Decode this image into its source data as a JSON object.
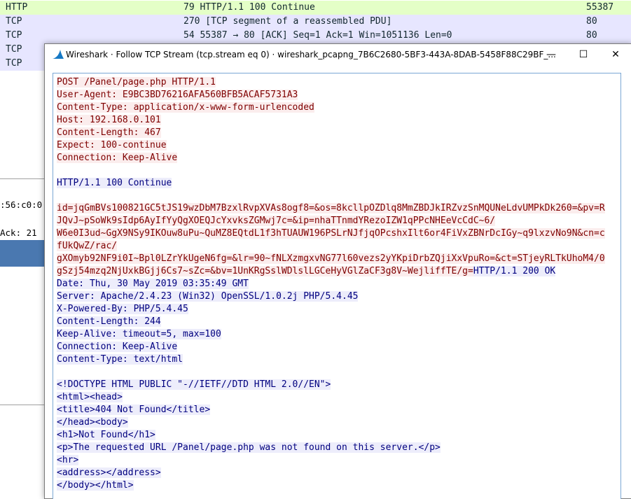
{
  "packet_list": [
    {
      "proto": "HTTP",
      "info": "79 HTTP/1.1 100 Continue",
      "port": "55387",
      "bg": "#e4ffc7"
    },
    {
      "proto": "TCP",
      "info": "270 [TCP segment of a reassembled PDU]",
      "port": "80",
      "bg": "#e7e6ff"
    },
    {
      "proto": "TCP",
      "info": "54 55387 → 80 [ACK] Seq=1 Ack=1 Win=1051136 Len=0",
      "port": "80",
      "bg": "#e7e6ff"
    },
    {
      "proto": "TCP",
      "info": "",
      "port": "",
      "bg": "#e7e6ff"
    },
    {
      "proto": "TCP",
      "info": "",
      "port": "",
      "bg": "#e7e6ff"
    }
  ],
  "background_details": {
    "mac_fragment": ":56:c0:0",
    "ack_fragment": "Ack: 21"
  },
  "dialog": {
    "title": "Wireshark · Follow TCP Stream (tcp.stream eq 0) · wireshark_pcapng_7B6C2680-5BF3-443A-8DAB-5458F88C29BF_...",
    "minimize": "—",
    "maximize": "☐",
    "close": "✕"
  },
  "stream": {
    "request_headers": "POST /Panel/page.php HTTP/1.1\nUser-Agent: E9BC3BD76216AFA560BFB5ACAF5731A3\nContent-Type: application/x-www-form-urlencoded\nHost: 192.168.0.101\nContent-Length: 467\nExpect: 100-continue\nConnection: Keep-Alive",
    "continue_response": "HTTP/1.1 100 Continue",
    "request_body": "id=jqGmBVs100821GC5tJS19wzDbM7BzxlRvpXVAs8ogf8=&os=8kcllpOZDlq8MmZBDJkIRZvzSnMQUNeLdvUMPkDk260=&pv=R\nJQvJ~pSoWk9sIdp6AyIfYyQgXOEQJcYxvksZGMwj7c=&ip=nhaTTnmdYRezoIZW1qPPcNHEeVcCdC~6/\nW6e0I3ud~GgX9NSy9IKOuw8uPu~QuMZ8EQtdL1f3hTUAUW196PSLrNJfjqOPcshxIlt6or4FiVxZBNrDcIGy~q9lxzvNo9N&cn=c\nfUkQwZ/rac/\ngXOmyb92NF9i0I~Bpl0LZrYkUgeN6fg=&lr=90~fNLXzmgxvNG77l60vezs2yYKpiDrbZQjiXxVpuRo=&ct=STjeyRLTkUhoM4/0\ngSzj54mzq2NjUxkBGjj6Cs7~sZc=&bv=1UnKRgSslWDlslLGCeHyVGlZaCF3g8V~WejliffTE/g=",
    "response_status": "HTTP/1.1 200 OK",
    "response_headers": "Date: Thu, 30 May 2019 03:35:49 GMT\nServer: Apache/2.4.23 (Win32) OpenSSL/1.0.2j PHP/5.4.45\nX-Powered-By: PHP/5.4.45\nContent-Length: 244\nKeep-Alive: timeout=5, max=100\nConnection: Keep-Alive\nContent-Type: text/html",
    "response_body": "<!DOCTYPE HTML PUBLIC \"-//IETF//DTD HTML 2.0//EN\">\n<html><head>\n<title>404 Not Found</title>\n</head><body>\n<h1>Not Found</h1>\n<p>The requested URL /Panel/page.php was not found on this server.</p>\n<hr>\n<address></address>\n</body></html>"
  },
  "colors": {
    "client_text": "#7f0000",
    "client_bg": "#fbeded",
    "server_text": "#00007f",
    "server_bg": "#ededfb",
    "selection_blue": "#4a78b0"
  }
}
